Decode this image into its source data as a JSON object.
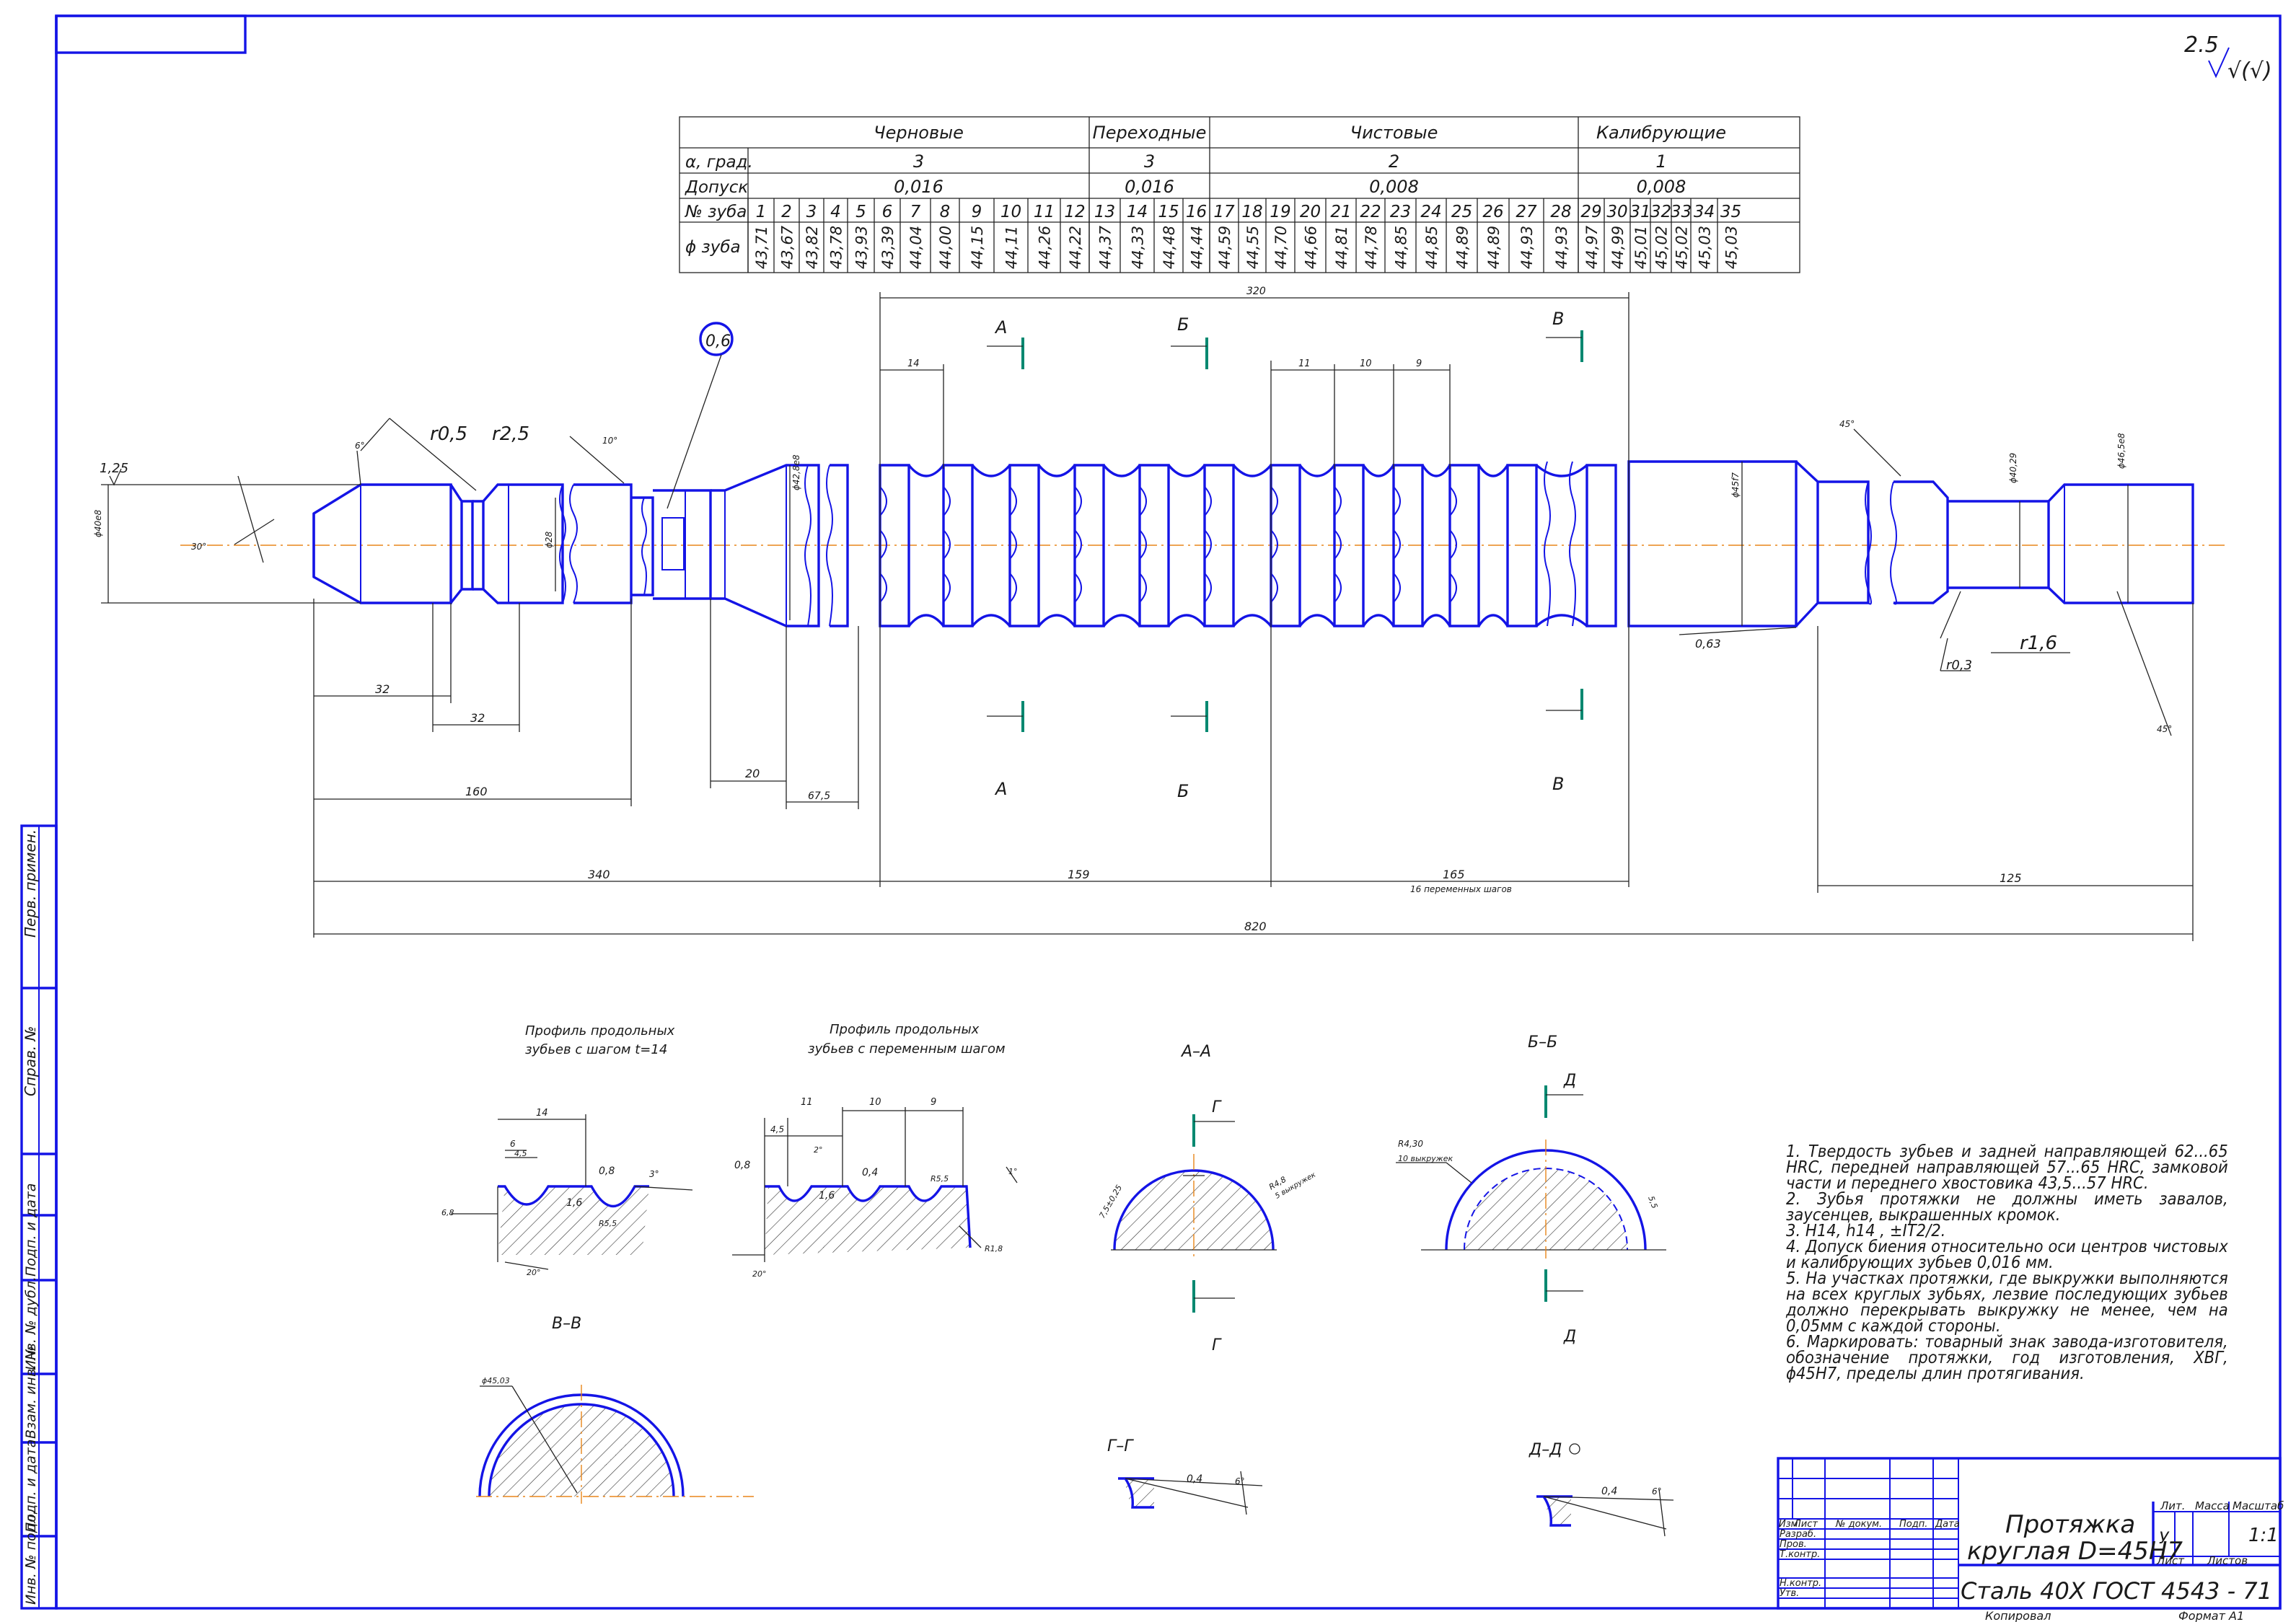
{
  "roughness": {
    "value": "2.5",
    "symbol": "√(√)"
  },
  "tooth_table": {
    "groups": [
      "Черновые",
      "Переходные",
      "Чистовые",
      "Калибрующие"
    ],
    "row_labels": {
      "alpha": "α, град.",
      "tol": "Допуск",
      "num": "№ зуба",
      "dia": "ϕ зуба"
    },
    "alpha": [
      "3",
      "3",
      "2",
      "1"
    ],
    "tolerance": [
      "0,016",
      "0,016",
      "0,008",
      "0,008"
    ],
    "tooth_numbers": [
      "1",
      "2",
      "3",
      "4",
      "5",
      "6",
      "7",
      "8",
      "9",
      "10",
      "11",
      "12",
      "13",
      "14",
      "15",
      "16",
      "17",
      "18",
      "19",
      "20",
      "21",
      "22",
      "23",
      "24",
      "25",
      "26",
      "27",
      "28",
      "29",
      "30",
      "31",
      "32",
      "33",
      "34",
      "35"
    ],
    "diameters": [
      "43,71",
      "43,67",
      "43,82",
      "43,78",
      "43,93",
      "43,39",
      "44,04",
      "44,00",
      "44,15",
      "44,11",
      "44,26",
      "44,22",
      "44,37",
      "44,33",
      "44,48",
      "44,44",
      "44,59",
      "44,55",
      "44,70",
      "44,66",
      "44,81",
      "44,78",
      "44,85",
      "44,85",
      "44,89",
      "44,89",
      "44,93",
      "44,93",
      "44,97",
      "44,99",
      "45,01",
      "45,02",
      "45,02",
      "45,03",
      "45,03"
    ]
  },
  "dimensions": {
    "d320": "320",
    "d14": "14",
    "d11": "11",
    "d10": "10",
    "d9": "9",
    "d32a": "32",
    "d32b": "32",
    "d20": "20",
    "d675": "67,5",
    "d160": "160",
    "d340": "340",
    "d159": "159",
    "d165": "165",
    "d165_note": "16 переменных шагов",
    "d125": "125",
    "d820": "820",
    "r05": "r0,5",
    "r25": "r2,5",
    "r16": "r1,6",
    "r03": "r0,3",
    "ra125": "1,25",
    "ra063": "0,63",
    "a30": "30°",
    "a6": "6°",
    "a10": "10°",
    "a45a": "45°",
    "a45b": "45°",
    "d_shank": "ϕ40e8",
    "d_neck": "ϕ28",
    "d_front": "ϕ42,8e8",
    "d_rear": "ϕ45f7",
    "d_n1": "ϕ40,29",
    "d_n2": "ϕ46,5e8",
    "circle_label": "0,6"
  },
  "section_marks": {
    "A": "А",
    "B": "Б",
    "V": "В"
  },
  "details": {
    "prof1_title": [
      "Профиль продольных",
      "зубьев с шагом t=14"
    ],
    "prof1_dims": {
      "p14": "14",
      "p6": "6",
      "p45": "4,5",
      "p08": "0,8",
      "p3": "3°",
      "p16": "1,6",
      "p55": "R5,5",
      "p8": "6,8",
      "p20": "20°"
    },
    "prof2_title": [
      "Профиль продольных",
      "зубьев с переменным шагом"
    ],
    "prof2_dims": {
      "q11": "11",
      "q10": "10",
      "q9": "9",
      "q45": "4,5",
      "q2": "2°",
      "q08": "0,8",
      "q16": "1,6",
      "q04": "0,4",
      "q55": "R5,5",
      "q1": "1°",
      "q18": "R1,8",
      "q20": "20°"
    },
    "sec_aa": "А–А",
    "sec_bb": "Б–Б",
    "sec_vv": "В–В",
    "sec_gg": "Г–Г",
    "sec_dd": "Д–Д",
    "mark_g": "Г",
    "mark_d": "Д",
    "aa_dims": {
      "ang": "7,5±0,25",
      "r": "R4,8",
      "n": "5 выкружек"
    },
    "bb_dims": {
      "a": "R4,30",
      "b": "10 выкружек",
      "c": "5,5"
    },
    "vv_dim": "ϕ45,03",
    "gg_dims": {
      "w": "0,4",
      "a": "6°"
    },
    "dd_dims": {
      "w": "0,4",
      "a": "6°"
    }
  },
  "notes": [
    "1. Твердость зубьев и задней направляющей 62...65 HRC, передней направляющей 57...65 HRC, замковой части и переднего хвостовика 43,5...57 HRC.",
    "2. Зубья протяжки не должны иметь завалов, заусенцев, выкрашенных кромок.",
    "3. H14, h14 , ±IT2/2.",
    "4. Допуск биения относительно оси центров чистовых и калибрующих зубьев 0,016 мм.",
    "5. На участках протяжки, где выкружки выполняются на всех круглых зубьях, лезвие последующих зубьев должно перекрывать выкружку не менее, чем на 0,05мм с каждой стороны.",
    "6. Маркировать: товарный знак завода-изготовителя, обозначение протяжки, год изготовления, ХВГ, ϕ45H7, пределы длин протягивания."
  ],
  "title_block": {
    "name_line1": "Протяжка",
    "name_line2": "круглая D=45H7",
    "material": "Сталь 40Х ГОСТ 4543 - 71",
    "lit_label": "Лит.",
    "mass_label": "Масса",
    "scale_label": "Масштаб",
    "lit_value": "У",
    "scale_value": "1:1",
    "sheet_label": "Лист",
    "sheets_label": "Листов",
    "headers": [
      "Изм.",
      "Лист",
      "№ докум.",
      "Подп.",
      "Дата"
    ],
    "roles": [
      "Разраб.",
      "Пров.",
      "Т.контр.",
      "Н.контр.",
      "Утв."
    ],
    "copied": "Копировал",
    "format": "Формат А1"
  },
  "side_stamp": [
    "Перв. примен.",
    "Справ. №",
    "Подп. и дата",
    "Инв. № дубл.",
    "Взам. инв. №",
    "Подп. и дата",
    "Инв. № подл."
  ]
}
